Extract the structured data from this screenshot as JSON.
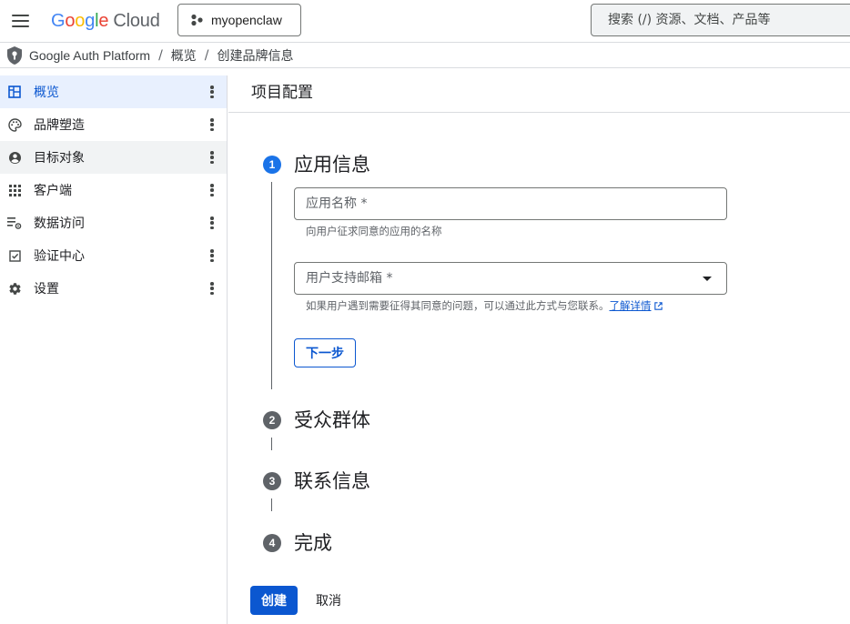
{
  "topbar": {
    "logo_g": "G",
    "logo_o1": "o",
    "logo_o2": "o",
    "logo_g2": "g",
    "logo_l": "l",
    "logo_e": "e",
    "logo_cloud": "Cloud",
    "project_name": "myopenclaw",
    "search_placeholder": "搜索 (/) 资源、文档、产品等"
  },
  "breadcrumb": {
    "items": [
      "Google Auth Platform",
      "概览",
      "创建品牌信息"
    ],
    "separator": "/"
  },
  "sidebar": {
    "items": [
      {
        "label": "概览",
        "icon": "dashboard-icon"
      },
      {
        "label": "品牌塑造",
        "icon": "palette-icon"
      },
      {
        "label": "目标对象",
        "icon": "account-circle-icon"
      },
      {
        "label": "客户端",
        "icon": "apps-grid-icon"
      },
      {
        "label": "数据访问",
        "icon": "data-access-icon"
      },
      {
        "label": "验证中心",
        "icon": "verification-icon"
      },
      {
        "label": "设置",
        "icon": "gear-icon"
      }
    ]
  },
  "main": {
    "title": "项目配置",
    "steps": [
      {
        "number": "1",
        "title": "应用信息"
      },
      {
        "number": "2",
        "title": "受众群体"
      },
      {
        "number": "3",
        "title": "联系信息"
      },
      {
        "number": "4",
        "title": "完成"
      }
    ],
    "app_name": {
      "placeholder": "应用名称 *",
      "hint": "向用户征求同意的应用的名称"
    },
    "support_email": {
      "placeholder": "用户支持邮箱 *",
      "hint": "如果用户遇到需要征得其同意的问题，可以通过此方式与您联系。",
      "learn_more": "了解详情"
    },
    "next_label": "下一步",
    "create_label": "创建",
    "cancel_label": "取消"
  },
  "colors": {
    "accent": "#0b57d0",
    "active_step": "#1a73e8",
    "inactive_step": "#5f6368",
    "active_nav_bg": "#e8f0fe"
  }
}
